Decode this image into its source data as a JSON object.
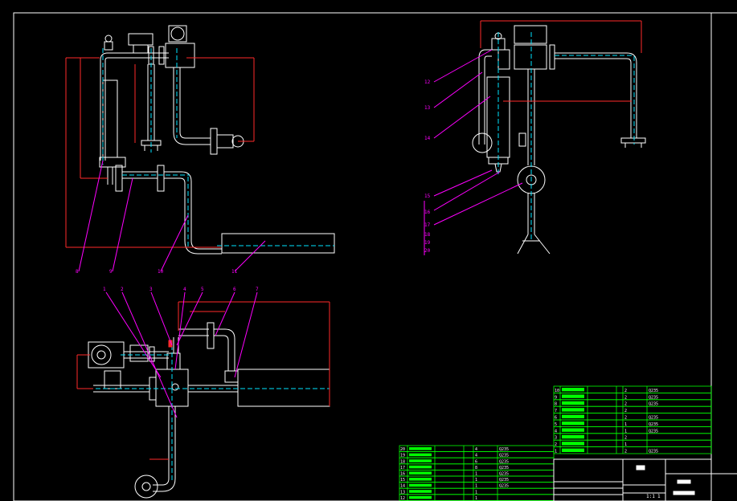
{
  "drawing": {
    "background": "#000000",
    "colors": {
      "pipe": "#ffffff",
      "centerline": "#00e5ff",
      "dimension": "#ff2a2a",
      "leader": "#ff00ff",
      "table": "#00ff00",
      "fill_mark": "#00ff00"
    }
  },
  "front_view_labels": [
    "8",
    "9",
    "10",
    "11"
  ],
  "side_view_labels": [
    "12",
    "13",
    "14",
    "15",
    "16",
    "17",
    "18",
    "19",
    "20"
  ],
  "plan_view_labels": [
    "1",
    "2",
    "3",
    "4",
    "5",
    "6",
    "7"
  ],
  "bom_upper": {
    "rows": [
      {
        "no": "10",
        "qty": "2",
        "mat": "Q235"
      },
      {
        "no": "9",
        "qty": "2",
        "mat": "Q235"
      },
      {
        "no": "8",
        "qty": "2",
        "mat": "Q235"
      },
      {
        "no": "7",
        "qty": "2",
        "mat": ""
      },
      {
        "no": "6",
        "qty": "2",
        "mat": "Q235"
      },
      {
        "no": "5",
        "qty": "1",
        "mat": "Q235"
      },
      {
        "no": "4",
        "qty": "1",
        "mat": "Q235"
      },
      {
        "no": "3",
        "qty": "2",
        "mat": ""
      },
      {
        "no": "2",
        "qty": "1",
        "mat": ""
      },
      {
        "no": "1",
        "qty": "2",
        "mat": "Q235"
      }
    ]
  },
  "bom_lower": {
    "rows": [
      {
        "no": "20",
        "qty": "4",
        "mat": "Q235"
      },
      {
        "no": "19",
        "qty": "4",
        "mat": "Q235"
      },
      {
        "no": "18",
        "qty": "6",
        "mat": "Q235"
      },
      {
        "no": "17",
        "qty": "8",
        "mat": "Q235"
      },
      {
        "no": "16",
        "qty": "1",
        "mat": "Q235"
      },
      {
        "no": "15",
        "qty": "1",
        "mat": "Q235"
      },
      {
        "no": "14",
        "qty": "1",
        "mat": "Q235"
      },
      {
        "no": "13",
        "qty": "1",
        "mat": ""
      },
      {
        "no": "12",
        "qty": "1",
        "mat": ""
      }
    ]
  },
  "title_block": {
    "scale_label": "1:1",
    "sheet": "1"
  }
}
